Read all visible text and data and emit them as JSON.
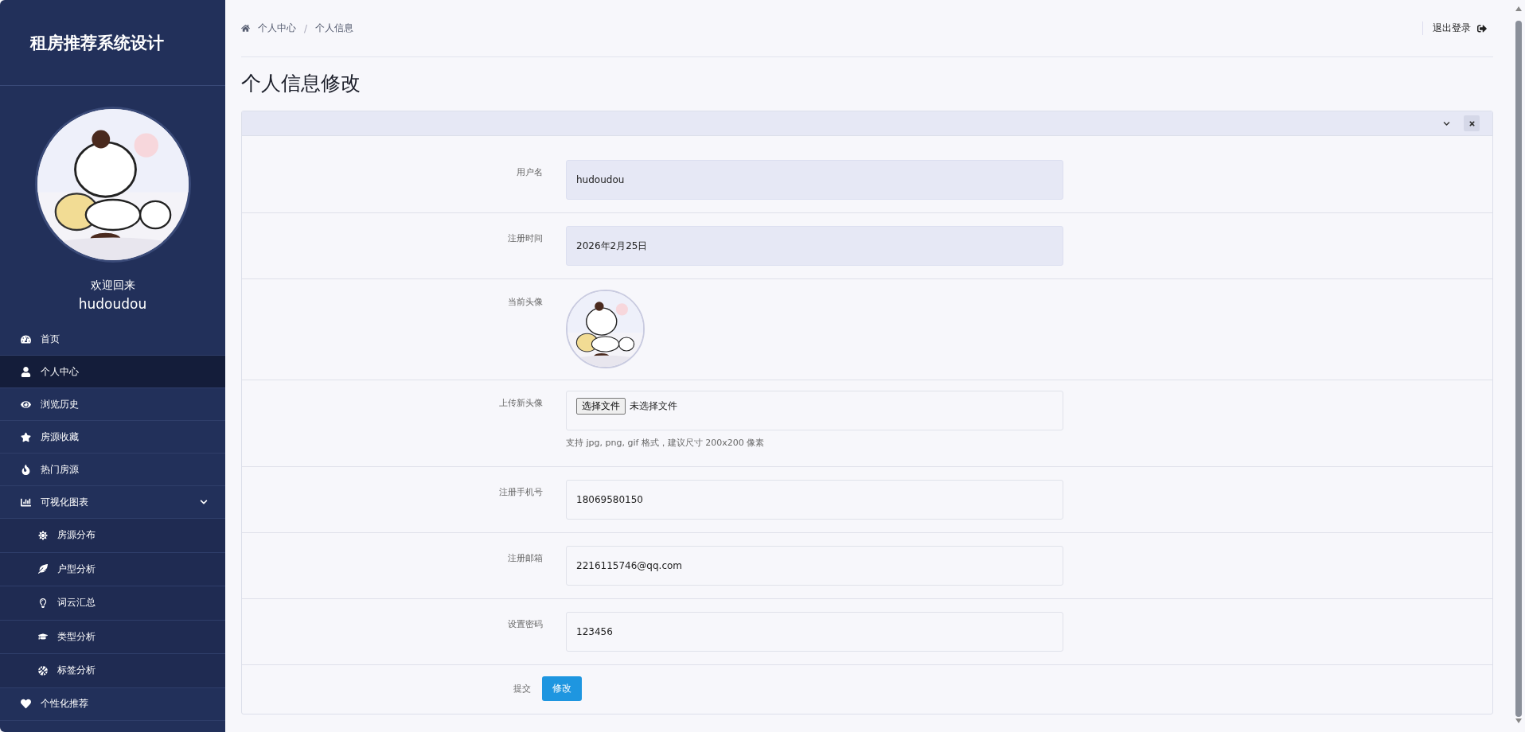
{
  "sidebar": {
    "title": "租房推荐系统设计",
    "user": {
      "greeting": "欢迎回来",
      "name": "hudoudou"
    },
    "items": [
      {
        "label": "首页",
        "selected": false
      },
      {
        "label": "个人中心",
        "selected": true
      },
      {
        "label": "浏览历史",
        "selected": false
      },
      {
        "label": "房源收藏",
        "selected": false
      },
      {
        "label": "热门房源",
        "selected": false
      },
      {
        "label": "可视化图表",
        "selected": false,
        "expanded": true,
        "children": [
          {
            "label": "房源分布",
            "selected": false
          },
          {
            "label": "户型分析",
            "selected": false
          },
          {
            "label": "词云汇总",
            "selected": false
          },
          {
            "label": "类型分析",
            "selected": false
          },
          {
            "label": "标签分析",
            "selected": false
          }
        ]
      },
      {
        "label": "个性化推荐",
        "selected": false
      }
    ]
  },
  "header": {
    "breadcrumb": [
      "个人中心",
      "个人信息"
    ],
    "breadcrumb_separator": "/",
    "logout": "退出登录"
  },
  "page": {
    "title": "个人信息修改",
    "form": {
      "fields": [
        {
          "kind": "readonly",
          "label": "用户名",
          "value": "hudoudou"
        },
        {
          "kind": "readonly",
          "label": "注册时间",
          "value": "2026年2月25日"
        },
        {
          "kind": "avatar",
          "label": "当前头像"
        },
        {
          "kind": "file",
          "label": "上传新头像",
          "button": "选择文件",
          "status": "未选择文件",
          "help": "支持 jpg, png, gif 格式，建议尺寸 200x200 像素"
        },
        {
          "kind": "text",
          "label": "注册手机号",
          "value": "18069580150"
        },
        {
          "kind": "text",
          "label": "注册邮箱",
          "value": "2216115746@qq.com"
        },
        {
          "kind": "text",
          "label": "设置密码",
          "value": "123456"
        }
      ],
      "submit": {
        "label": "提交",
        "button": "修改"
      }
    }
  }
}
